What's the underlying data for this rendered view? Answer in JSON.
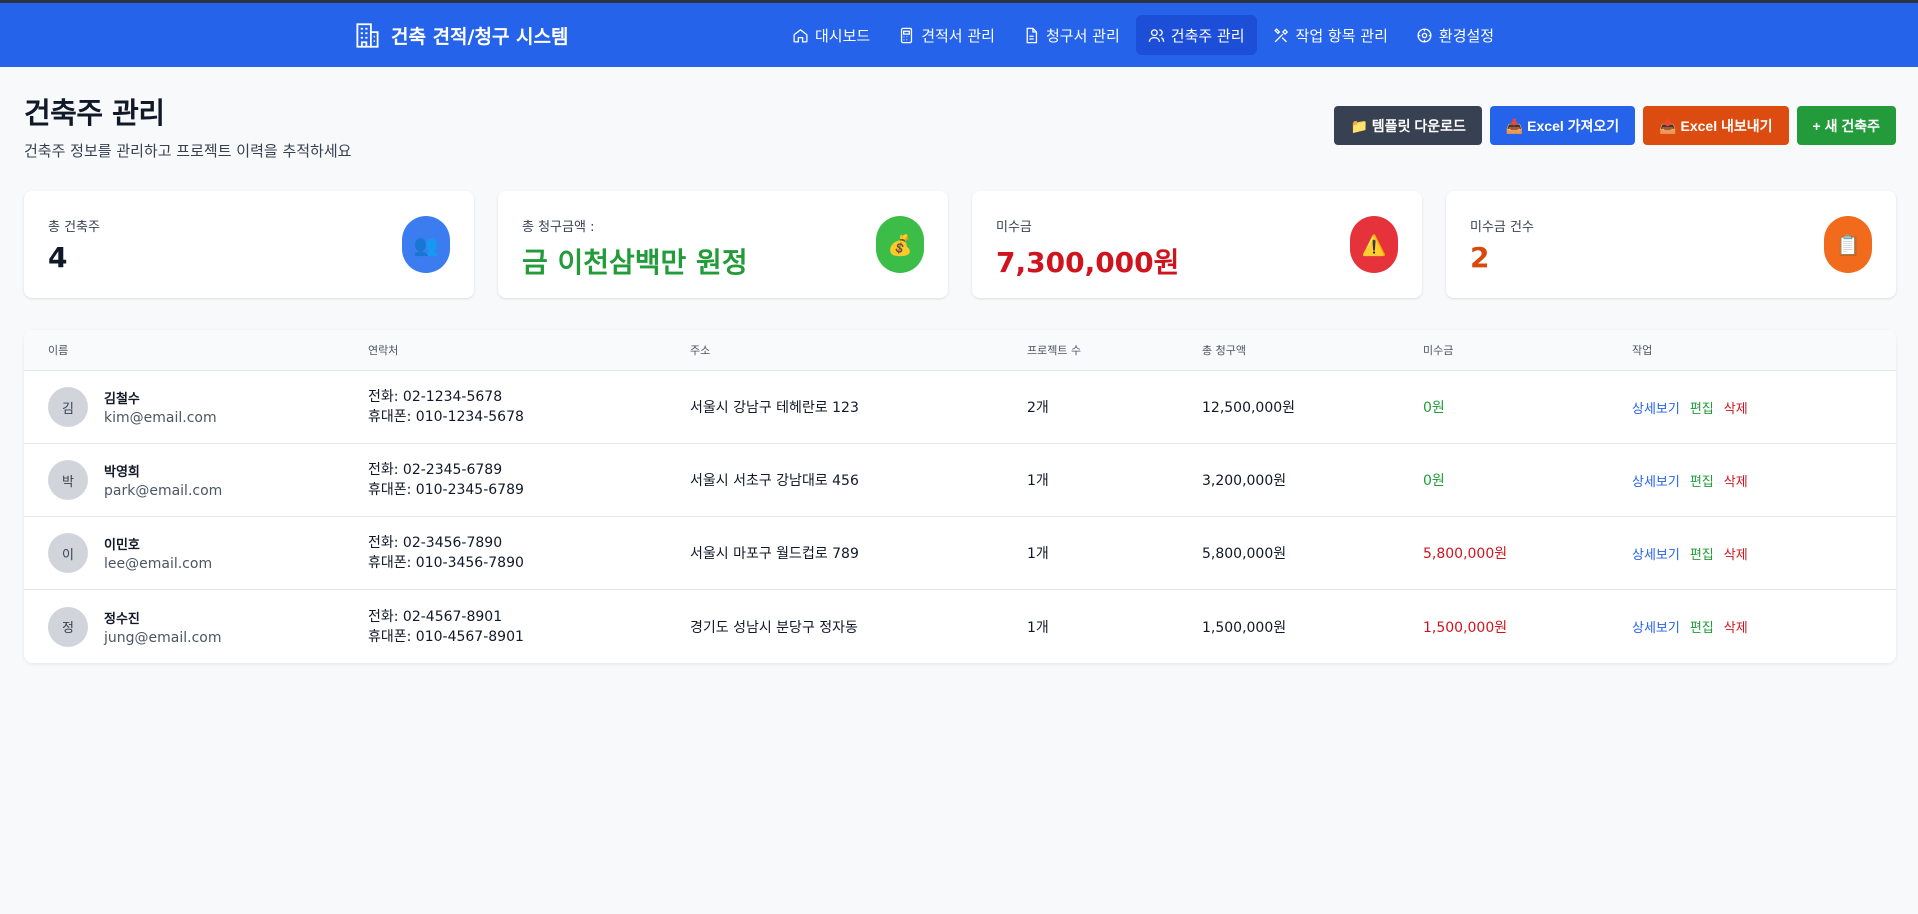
{
  "nav": {
    "brand": "건축 견적/청구 시스템",
    "items": [
      {
        "label": "대시보드",
        "icon": "home-icon",
        "active": false
      },
      {
        "label": "견적서 관리",
        "icon": "calculator-icon",
        "active": false
      },
      {
        "label": "청구서 관리",
        "icon": "document-icon",
        "active": false
      },
      {
        "label": "건축주 관리",
        "icon": "users-icon",
        "active": true
      },
      {
        "label": "작업 항목 관리",
        "icon": "tools-icon",
        "active": false
      },
      {
        "label": "환경설정",
        "icon": "gear-icon",
        "active": false
      }
    ]
  },
  "header": {
    "title": "건축주 관리",
    "subtitle": "건축주 정보를 관리하고 프로젝트 이력을 추적하세요"
  },
  "actions": {
    "template": "📁 템플릿 다운로드",
    "import": "📥 Excel 가져오기",
    "export": "📤 Excel 내보내기",
    "new": "+ 새 건축주"
  },
  "stats": [
    {
      "label": "총 건축주",
      "value": "4",
      "icon": "👥"
    },
    {
      "label": "총 청구금액 :",
      "value": "금 이천삼백만 원정",
      "icon": "💰"
    },
    {
      "label": "미수금",
      "value": "7,300,000원",
      "icon": "⚠️"
    },
    {
      "label": "미수금 건수",
      "value": "2",
      "icon": "📋"
    }
  ],
  "table": {
    "headers": [
      "이름",
      "연락처",
      "주소",
      "프로젝트 수",
      "총 청구액",
      "미수금",
      "작업"
    ],
    "rows": [
      {
        "initial": "김",
        "name": "김철수",
        "email": "kim@email.com",
        "phone": "전화: 02-1234-5678",
        "mobile": "휴대폰: 010-1234-5678",
        "address": "서울시 강남구 테헤란로 123",
        "projects": "2개",
        "total": "12,500,000원",
        "due": "0원"
      },
      {
        "initial": "박",
        "name": "박영희",
        "email": "park@email.com",
        "phone": "전화: 02-2345-6789",
        "mobile": "휴대폰: 010-2345-6789",
        "address": "서울시 서초구 강남대로 456",
        "projects": "1개",
        "total": "3,200,000원",
        "due": "0원"
      },
      {
        "initial": "이",
        "name": "이민호",
        "email": "lee@email.com",
        "phone": "전화: 02-3456-7890",
        "mobile": "휴대폰: 010-3456-7890",
        "address": "서울시 마포구 월드컵로 789",
        "projects": "1개",
        "total": "5,800,000원",
        "due": "5,800,000원"
      },
      {
        "initial": "정",
        "name": "정수진",
        "email": "jung@email.com",
        "phone": "전화: 02-4567-8901",
        "mobile": "휴대폰: 010-4567-8901",
        "address": "경기도 성남시 분당구 정자동",
        "projects": "1개",
        "total": "1,500,000원",
        "due": "1,500,000원"
      }
    ],
    "row_actions": {
      "view": "상세보기",
      "edit": "편집",
      "delete": "삭제"
    }
  },
  "colors": {
    "nav": "#2563eb",
    "active_nav": "#1d4ed8",
    "green": "#239b3a",
    "red": "#d0141e",
    "orange": "#d9490c"
  }
}
